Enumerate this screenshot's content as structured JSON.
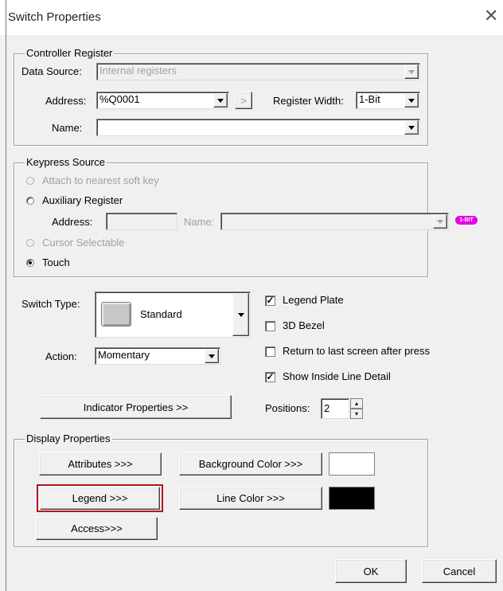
{
  "window": {
    "title": "Switch Properties",
    "close_glyph": "✕"
  },
  "controller_register": {
    "group_label": "Controller Register",
    "data_source_label": "Data Source:",
    "data_source_value": "Internal registers",
    "address_label": "Address:",
    "address_value": "%Q0001",
    "browse_glyph": ">",
    "register_width_label": "Register Width:",
    "register_width_value": "1-Bit",
    "name_label": "Name:",
    "name_value": ""
  },
  "keypress_source": {
    "group_label": "Keypress Source",
    "options": {
      "nearest_soft_key": "Attach to nearest soft key",
      "auxiliary_register": "Auxiliary Register",
      "cursor_selectable": "Cursor Selectable",
      "touch": "Touch"
    },
    "selected": "Touch",
    "aux_address_label": "Address:",
    "aux_name_label": "Name:",
    "badge": "1-BIT"
  },
  "switch": {
    "type_label": "Switch Type:",
    "type_value": "Standard",
    "action_label": "Action:",
    "action_value": "Momentary",
    "indicator_button": "Indicator Properties >>",
    "positions_label": "Positions:",
    "positions_value": "2"
  },
  "checkboxes": {
    "legend_plate": {
      "label": "Legend Plate",
      "checked": true
    },
    "bezel_3d": {
      "label": "3D Bezel",
      "checked": false
    },
    "return_last_screen": {
      "label": "Return to last screen after press",
      "checked": false
    },
    "show_inside_line": {
      "label": "Show Inside Line Detail",
      "checked": true
    }
  },
  "display_properties": {
    "group_label": "Display Properties",
    "attributes_button": "Attributes >>>",
    "background_color_button": "Background Color >>>",
    "background_color": "#ffffff",
    "legend_button": "Legend >>>",
    "line_color_button": "Line Color >>>",
    "line_color": "#000000",
    "access_button": "Access>>>"
  },
  "footer": {
    "ok_button": "OK",
    "cancel_button": "Cancel"
  },
  "colors": {
    "highlight": "#b5151d",
    "badge": "#e600e6"
  }
}
